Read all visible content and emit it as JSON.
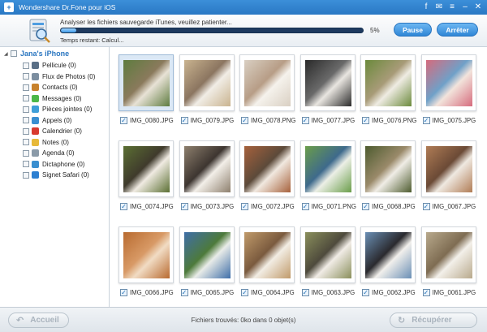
{
  "window": {
    "title": "Wondershare Dr.Fone pour iOS",
    "controls": [
      "facebook-icon",
      "feedback-icon",
      "menu-icon",
      "minimize-icon",
      "close-icon"
    ]
  },
  "header": {
    "status": "Analyser les fichiers sauvegarde iTunes, veuillez patienter...",
    "progress_percent": 5,
    "progress_label": "5%",
    "time_remaining": "Temps restant: Calcul...",
    "pause_label": "Pause",
    "stop_label": "Arrêter"
  },
  "sidebar": {
    "device": "Jana's iPhone",
    "categories": [
      {
        "label": "Pellicule (0)",
        "icon": "camera-icon",
        "color": "#5a6f86"
      },
      {
        "label": "Flux de Photos (0)",
        "icon": "photo-stream-icon",
        "color": "#7c8ea0"
      },
      {
        "label": "Contacts (0)",
        "icon": "contacts-icon",
        "color": "#c8822c"
      },
      {
        "label": "Messages (0)",
        "icon": "messages-icon",
        "color": "#4cb848"
      },
      {
        "label": "Pièces jointes (0)",
        "icon": "attachment-icon",
        "color": "#3f9fd8"
      },
      {
        "label": "Appels (0)",
        "icon": "phone-icon",
        "color": "#3a8fd0"
      },
      {
        "label": "Calendrier (0)",
        "icon": "calendar-icon",
        "color": "#d83a2e"
      },
      {
        "label": "Notes (0)",
        "icon": "notes-icon",
        "color": "#e7b93a"
      },
      {
        "label": "Agenda (0)",
        "icon": "agenda-icon",
        "color": "#8a9aa8"
      },
      {
        "label": "Dictaphone (0)",
        "icon": "dictaphone-icon",
        "color": "#3a8fd0"
      },
      {
        "label": "Signet Safari (0)",
        "icon": "safari-icon",
        "color": "#2c7fd1"
      }
    ]
  },
  "photos": [
    {
      "name": "IMG_0080.JPG",
      "colors": [
        "#5e7c3f",
        "#e8e2d6",
        "#8a7a5c"
      ]
    },
    {
      "name": "IMG_0079.JPG",
      "colors": [
        "#c9b38f",
        "#f1ede6",
        "#8b7560"
      ]
    },
    {
      "name": "IMG_0078.PNG",
      "colors": [
        "#d9cfc2",
        "#f5f2ec",
        "#b79d86"
      ]
    },
    {
      "name": "IMG_0077.JPG",
      "colors": [
        "#2a2a2a",
        "#e9e6e1",
        "#6a6a6a"
      ]
    },
    {
      "name": "IMG_0076.PNG",
      "colors": [
        "#6b8a3c",
        "#efece3",
        "#a89b78"
      ]
    },
    {
      "name": "IMG_0075.JPG",
      "colors": [
        "#d66b7d",
        "#f2e4dc",
        "#6fa0c8"
      ]
    },
    {
      "name": "IMG_0074.JPG",
      "colors": [
        "#5b6f33",
        "#f0ebe2",
        "#3f3a2c"
      ]
    },
    {
      "name": "IMG_0073.JPG",
      "colors": [
        "#8d7f6d",
        "#f3efe9",
        "#3d3530"
      ]
    },
    {
      "name": "IMG_0072.JPG",
      "colors": [
        "#a6613c",
        "#f1e9e0",
        "#5c4a3a"
      ]
    },
    {
      "name": "IMG_0071.PNG",
      "colors": [
        "#6a9d4a",
        "#ecefe6",
        "#3e6a8c"
      ]
    },
    {
      "name": "IMG_0068.JPG",
      "colors": [
        "#4d5b2f",
        "#f0ede6",
        "#9a8a6a"
      ]
    },
    {
      "name": "IMG_0067.JPG",
      "colors": [
        "#b07c55",
        "#efe9e1",
        "#6b4a36"
      ]
    },
    {
      "name": "IMG_0066.JPG",
      "colors": [
        "#b86a2f",
        "#f1dcc4",
        "#d89a66"
      ]
    },
    {
      "name": "IMG_0065.JPG",
      "colors": [
        "#3f6ea8",
        "#e9ece8",
        "#4d7a3a"
      ]
    },
    {
      "name": "IMG_0064.JPG",
      "colors": [
        "#c09a6a",
        "#f2ede4",
        "#7a5a3e"
      ]
    },
    {
      "name": "IMG_0063.JPG",
      "colors": [
        "#8a8f5c",
        "#f1ece6",
        "#4e4a3c"
      ]
    },
    {
      "name": "IMG_0062.JPG",
      "colors": [
        "#6a8fb5",
        "#f2f0ec",
        "#2a2a2e"
      ]
    },
    {
      "name": "IMG_0061.JPG",
      "colors": [
        "#b8a98c",
        "#f3f0ea",
        "#7e6c52"
      ]
    }
  ],
  "footer": {
    "back_label": "Accueil",
    "found_text": "Fichiers trouvés: 0ko dans 0 objet(s)",
    "recover_label": "Récupérer"
  }
}
